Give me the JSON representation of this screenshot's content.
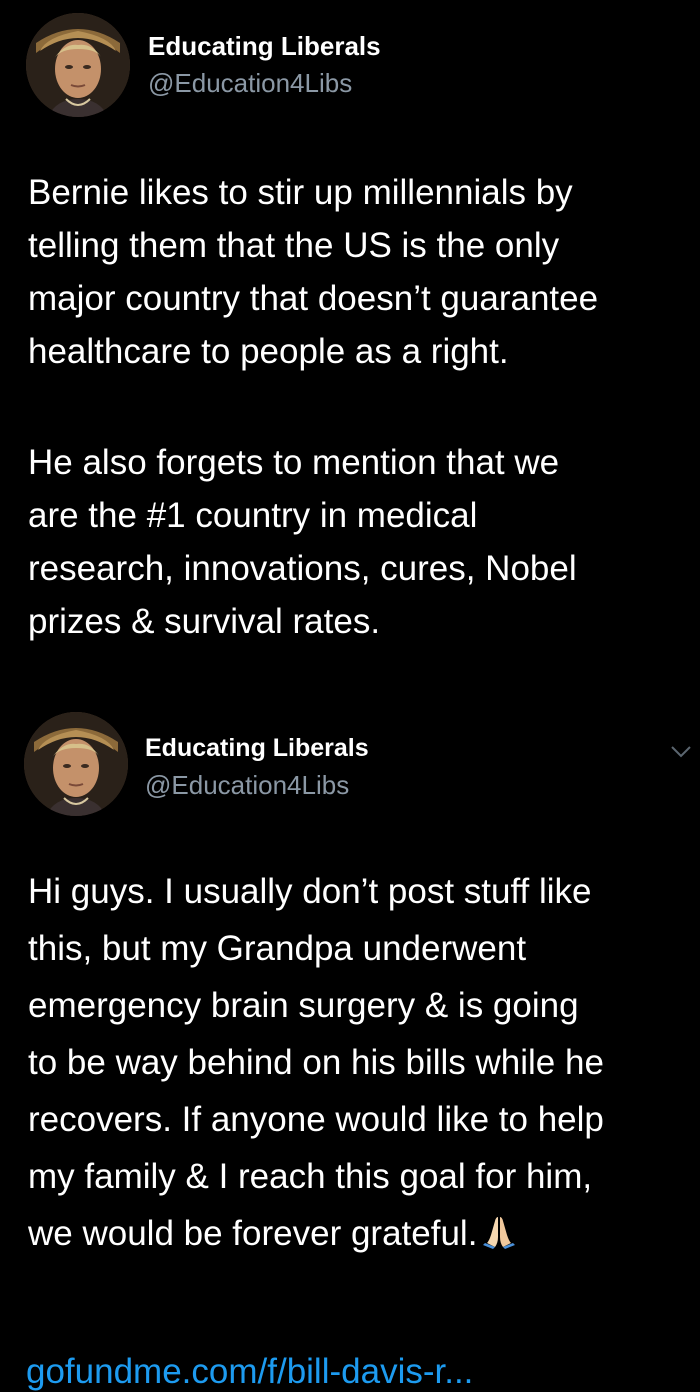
{
  "tweets": [
    {
      "author": {
        "name": "Educating Liberals",
        "handle": "@Education4Libs",
        "avatar_icon": "avatar-photo-icon"
      },
      "paragraphs": [
        {
          "lines": [
            "Bernie likes to stir up millennials by",
            "telling them that the US is the only",
            "major country that doesn’t guarantee",
            "healthcare to people as a right."
          ]
        },
        {
          "lines": [
            "He also forgets to mention that we",
            "are the #1 country in medical",
            "research, innovations, cures, Nobel",
            "prizes & survival rates."
          ]
        }
      ]
    },
    {
      "author": {
        "name": "Educating Liberals",
        "handle": "@Education4Libs",
        "avatar_icon": "avatar-photo-icon"
      },
      "menu_icon": "chevron-down-icon",
      "lines": [
        "Hi guys. I usually don’t post stuff like",
        "this, but my Grandpa underwent",
        "emergency brain surgery & is going",
        "to be way behind on his bills while he",
        "recovers. If anyone would like to help",
        "my family & I reach this goal for him,",
        "we would be forever grateful."
      ],
      "emoji_icon": "folded-hands-icon",
      "link_text": "gofundme.com/f/bill-davis-r..."
    }
  ],
  "colors": {
    "background": "#000000",
    "text": "#ffffff",
    "secondary_text": "#8b98a5",
    "link": "#1d9bf0"
  }
}
